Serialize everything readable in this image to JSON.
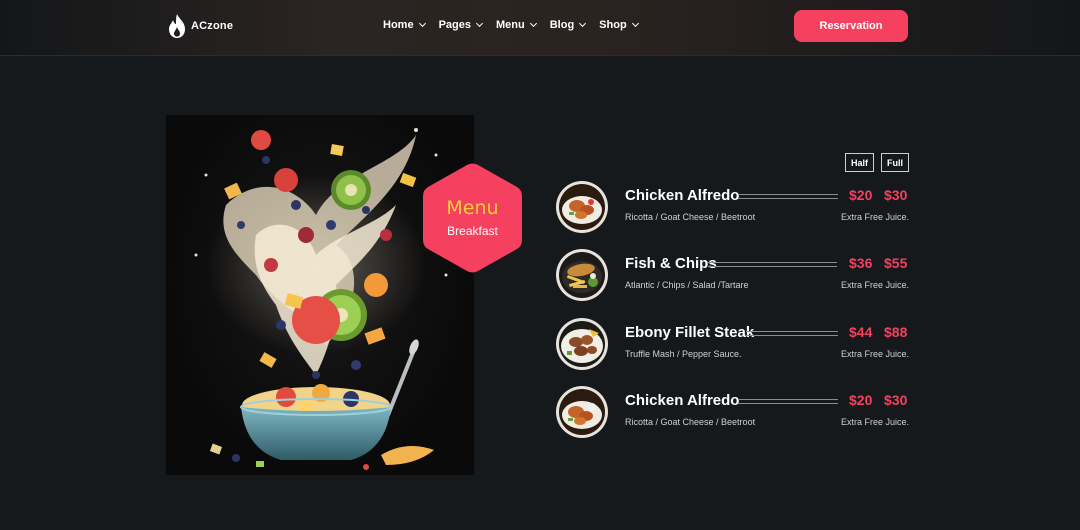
{
  "brand": {
    "name": "ACzone"
  },
  "nav": [
    {
      "label": "Home"
    },
    {
      "label": "Pages"
    },
    {
      "label": "Menu"
    },
    {
      "label": "Blog"
    },
    {
      "label": "Shop"
    }
  ],
  "header": {
    "cta_label": "Reservation"
  },
  "badge": {
    "title": "Menu",
    "subtitle": "Breakfast"
  },
  "sizes": {
    "half": "Half",
    "full": "Full"
  },
  "menu": [
    {
      "name": "Chicken Alfredo",
      "half_price": "$20",
      "full_price": "$30",
      "description": "Ricotta / Goat Cheese / Beetroot",
      "extra": "Extra Free Juice."
    },
    {
      "name": "Fish & Chips",
      "half_price": "$36",
      "full_price": "$55",
      "description": "Atlantic / Chips / Salad /Tartare",
      "extra": "Extra Free Juice."
    },
    {
      "name": "Ebony Fillet Steak",
      "half_price": "$44",
      "full_price": "$88",
      "description": "Truffle Mash / Pepper Sauce.",
      "extra": "Extra Free Juice."
    },
    {
      "name": "Chicken Alfredo",
      "half_price": "$20",
      "full_price": "$30",
      "description": "Ricotta / Goat Cheese / Beetroot",
      "extra": "Extra Free Juice."
    }
  ],
  "colors": {
    "accent": "#f5405f",
    "badge_title": "#ffcf3a",
    "background": "#16191c"
  },
  "icons": {
    "logo": "flame-icon",
    "dropdown": "chevron-down-icon"
  }
}
